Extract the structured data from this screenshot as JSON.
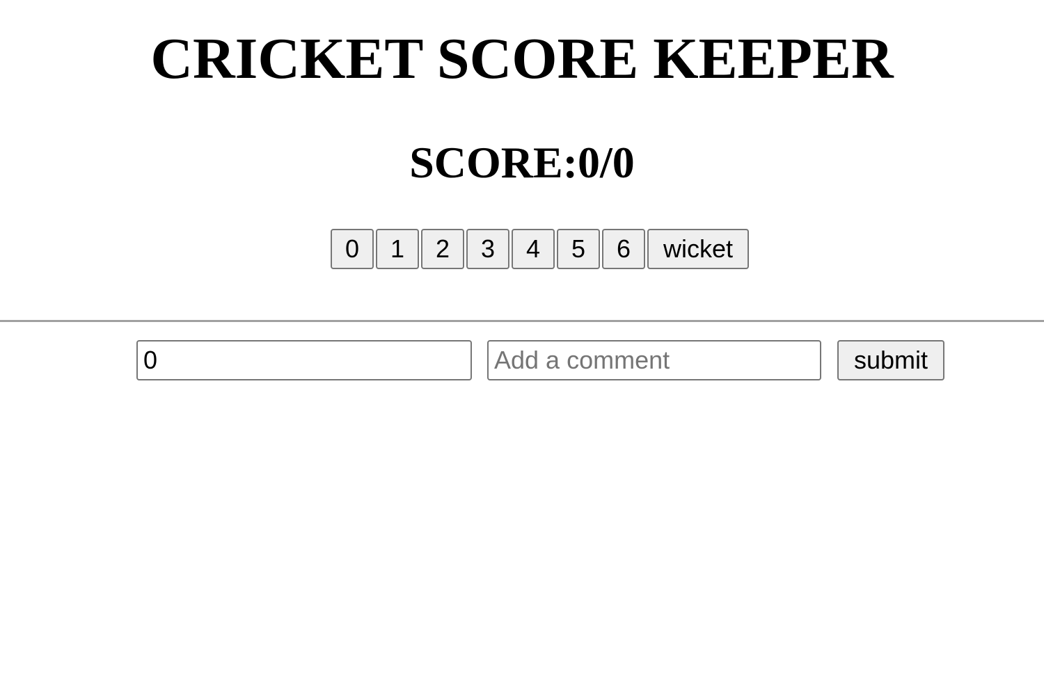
{
  "header": {
    "title": "CRICKET SCORE KEEPER"
  },
  "score": {
    "label": "SCORE:",
    "runs": "0",
    "separator": "/",
    "wickets": "0"
  },
  "run_buttons": {
    "zero": "0",
    "one": "1",
    "two": "2",
    "three": "3",
    "four": "4",
    "five": "5",
    "six": "6",
    "wicket": "wicket"
  },
  "comment_form": {
    "runs_value": "0",
    "comment_value": "",
    "comment_placeholder": "Add a comment",
    "submit_label": "submit"
  },
  "colors": {
    "button_bg": "#efefef",
    "border": "#767676",
    "divider": "#a0a0a0",
    "placeholder": "#757575"
  }
}
